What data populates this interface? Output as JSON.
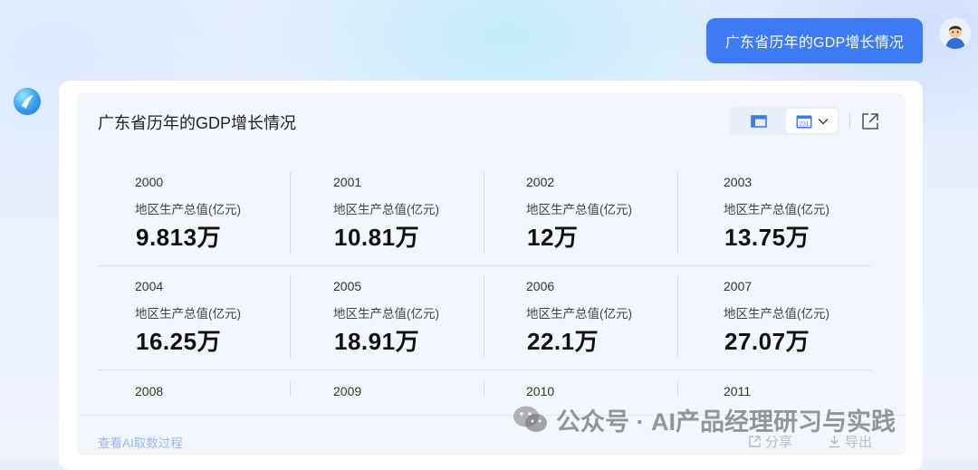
{
  "user_message": "广东省历年的GDP增长情况",
  "panel": {
    "title": "广东省历年的GDP增长情况",
    "view_toggle": {
      "left_icon": "table-view-icon",
      "right_icon": "calendar-icon",
      "right_icon_text": "231",
      "dropdown_icon": "chevron-down-icon"
    },
    "expand_icon": "expand-icon"
  },
  "metric_label": "地区生产总值(亿元)",
  "years": [
    {
      "year": "2000",
      "label": "地区生产总值(亿元)",
      "value": "9.813万"
    },
    {
      "year": "2001",
      "label": "地区生产总值(亿元)",
      "value": "10.81万"
    },
    {
      "year": "2002",
      "label": "地区生产总值(亿元)",
      "value": "12万"
    },
    {
      "year": "2003",
      "label": "地区生产总值(亿元)",
      "value": "13.75万"
    },
    {
      "year": "2004",
      "label": "地区生产总值(亿元)",
      "value": "16.25万"
    },
    {
      "year": "2005",
      "label": "地区生产总值(亿元)",
      "value": "18.91万"
    },
    {
      "year": "2006",
      "label": "地区生产总值(亿元)",
      "value": "22.1万"
    },
    {
      "year": "2007",
      "label": "地区生产总值(亿元)",
      "value": "27.07万"
    },
    {
      "year": "2008"
    },
    {
      "year": "2009"
    },
    {
      "year": "2010"
    },
    {
      "year": "2011"
    }
  ],
  "footer": {
    "ai_link": "查看AI取数过程",
    "share_label": "分享",
    "export_label": "导出"
  },
  "watermark": "公众号 · AI产品经理研习与实践",
  "colors": {
    "accent": "#3d7bf6",
    "link": "#9cb7ee"
  }
}
